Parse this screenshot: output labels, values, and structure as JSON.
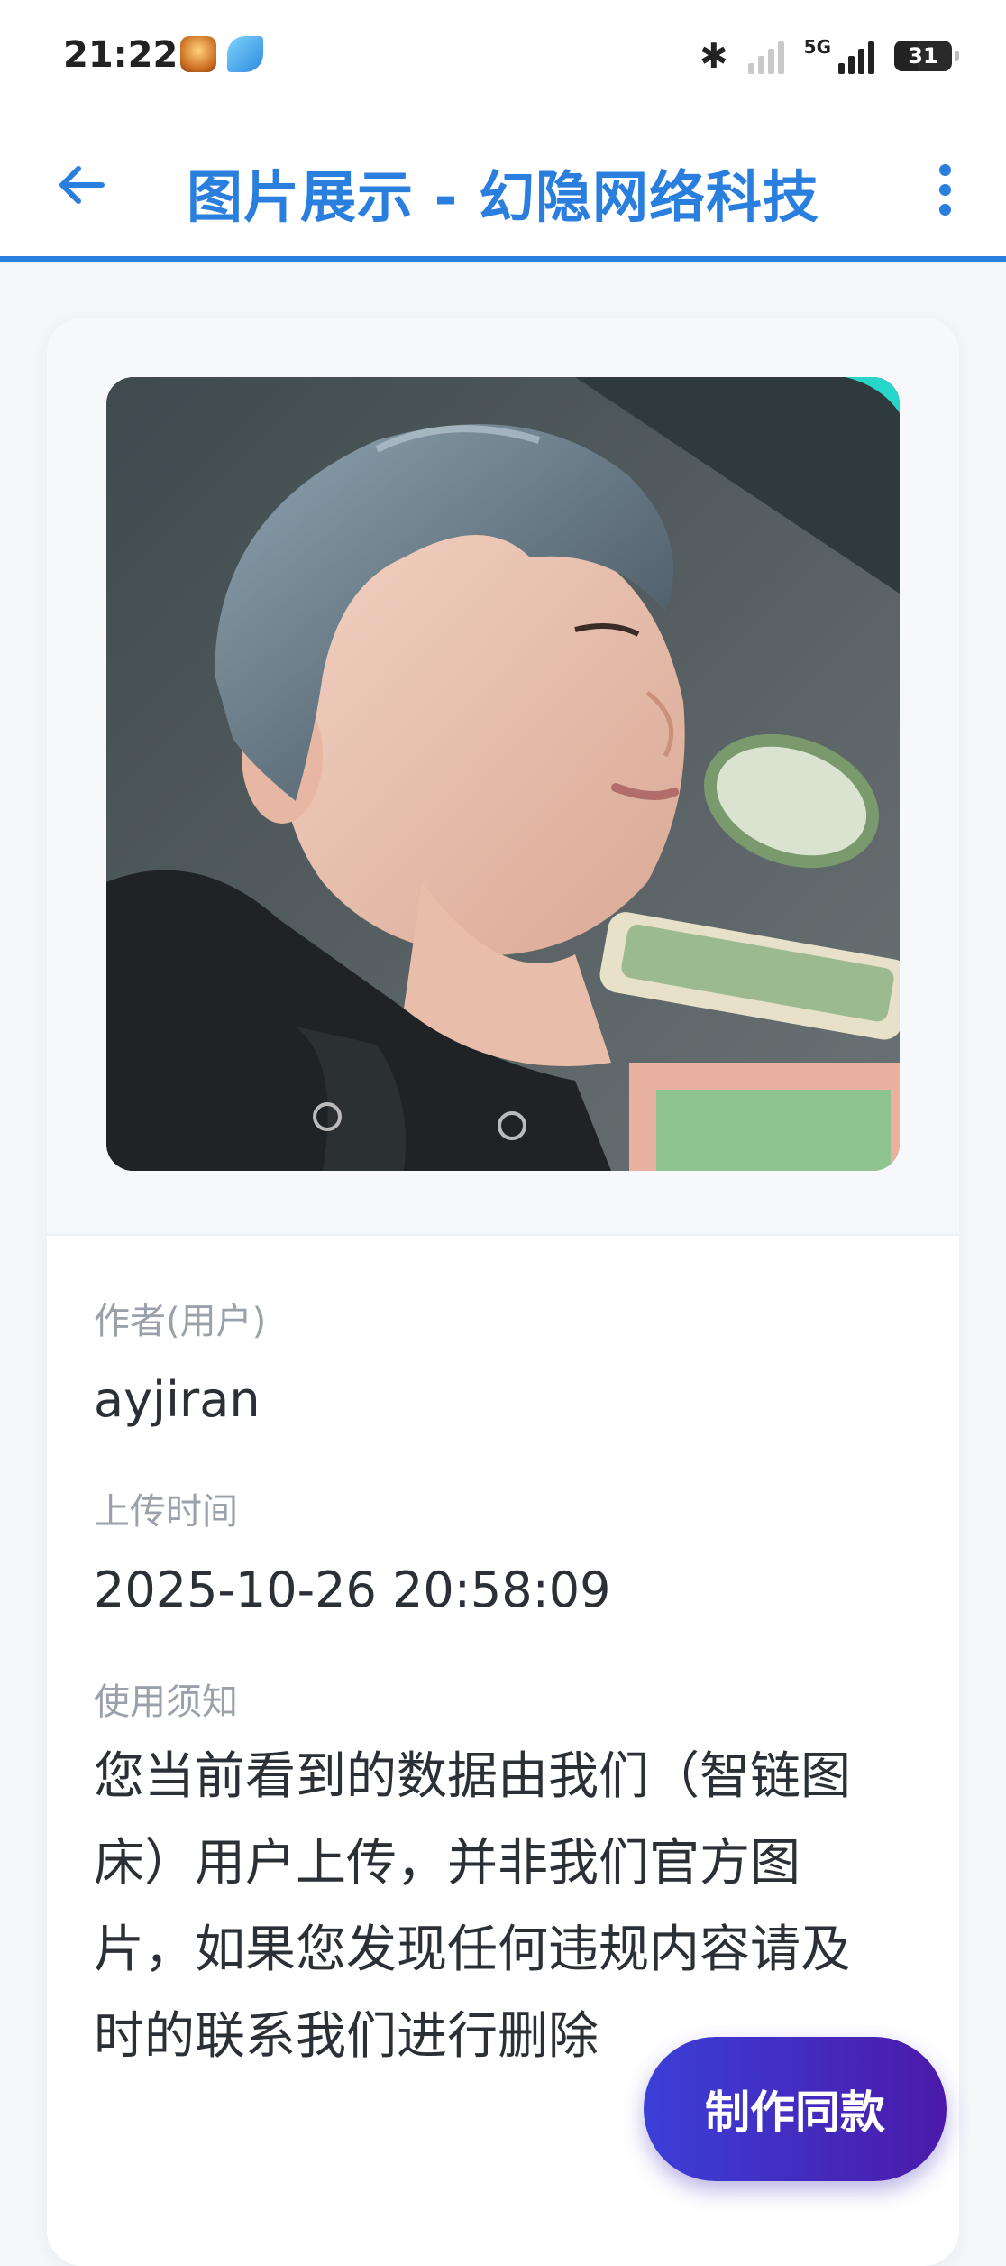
{
  "status_bar": {
    "time": "21:22",
    "network": "5G",
    "battery": "31"
  },
  "header": {
    "title": "图片展示 - 幻隐网络科技"
  },
  "image": {
    "alt": "用户上传的图片"
  },
  "details": {
    "author_label": "作者(用户)",
    "author_value": "ayjiran",
    "upload_time_label": "上传时间",
    "upload_time_value": "2025-10-26 20:58:09",
    "notice_label": "使用须知",
    "notice_text": "您当前看到的数据由我们（智链图床）用户上传，并非我们官方图片，如果您发现任何违规内容请及时的联系我们进行删除"
  },
  "actions": {
    "make_same_label": "制作同款"
  },
  "colors": {
    "accent": "#2a7fde",
    "button_start": "#3b3fd8",
    "button_end": "#4b1aa9"
  }
}
